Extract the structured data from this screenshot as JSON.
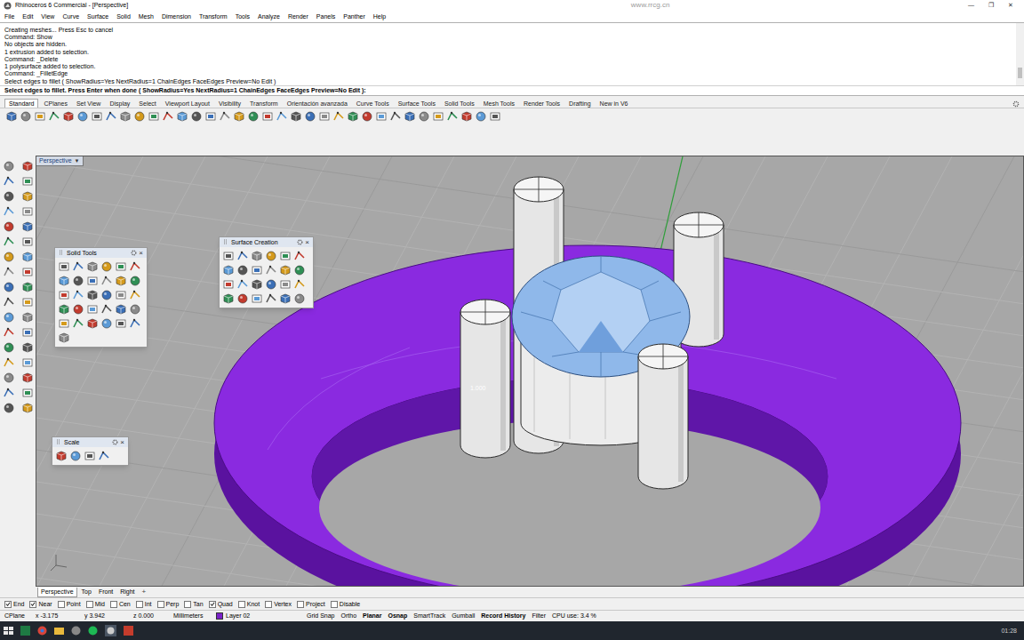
{
  "window": {
    "title": "Rhinoceros 6 Commercial - [Perspective]",
    "watermark": "www.rrcg.cn",
    "controls": [
      "—",
      "❐",
      "✕"
    ]
  },
  "menu": [
    "File",
    "Edit",
    "View",
    "Curve",
    "Surface",
    "Solid",
    "Mesh",
    "Dimension",
    "Transform",
    "Tools",
    "Analyze",
    "Render",
    "Panels",
    "Panther",
    "Help"
  ],
  "command_history": [
    "Creating meshes... Press Esc to cancel",
    "Command: Show",
    "No objects are hidden.",
    "1 extrusion added to selection.",
    "Command: _Delete",
    "1 polysurface added to selection.",
    "Command: _FilletEdge",
    "Select edges to fillet ( ShowRadius=Yes  NextRadius=1  ChainEdges  FaceEdges  Preview=No  Edit )"
  ],
  "command_prompt": "Select edges to fillet. Press Enter when done ( ShowRadius=Yes  NextRadius=1  ChainEdges  FaceEdges  Preview=No  Edit ):",
  "toolbar_tabs": [
    {
      "label": "Standard",
      "selected": true
    },
    {
      "label": "CPlanes",
      "selected": false
    },
    {
      "label": "Set View",
      "selected": false
    },
    {
      "label": "Display",
      "selected": false
    },
    {
      "label": "Select",
      "selected": false
    },
    {
      "label": "Viewport Layout",
      "selected": false
    },
    {
      "label": "Visibility",
      "selected": false
    },
    {
      "label": "Transform",
      "selected": false
    },
    {
      "label": "Orientación avanzada",
      "selected": false
    },
    {
      "label": "Curve Tools",
      "selected": false
    },
    {
      "label": "Surface Tools",
      "selected": false
    },
    {
      "label": "Solid Tools",
      "selected": false
    },
    {
      "label": "Mesh Tools",
      "selected": false
    },
    {
      "label": "Render Tools",
      "selected": false
    },
    {
      "label": "Drafting",
      "selected": false
    },
    {
      "label": "New in V6",
      "selected": false
    }
  ],
  "viewport": {
    "title": "Perspective",
    "dropdown": "▼",
    "dimension_label": "1.000"
  },
  "panels": [
    {
      "title": "Solid Tools",
      "close": "×"
    },
    {
      "title": "Surface Creation",
      "close": "×"
    },
    {
      "title": "Scale",
      "close": "×"
    }
  ],
  "viewport_tabs": [
    {
      "label": "Perspective",
      "selected": true
    },
    {
      "label": "Top",
      "selected": false
    },
    {
      "label": "Front",
      "selected": false
    },
    {
      "label": "Right",
      "selected": false
    }
  ],
  "add_tab": "+",
  "osnaps": [
    {
      "label": "End",
      "checked": true
    },
    {
      "label": "Near",
      "checked": true
    },
    {
      "label": "Point",
      "checked": false
    },
    {
      "label": "Mid",
      "checked": false
    },
    {
      "label": "Cen",
      "checked": false
    },
    {
      "label": "Int",
      "checked": false
    },
    {
      "label": "Perp",
      "checked": false
    },
    {
      "label": "Tan",
      "checked": false
    },
    {
      "label": "Quad",
      "checked": true
    },
    {
      "label": "Knot",
      "checked": false
    },
    {
      "label": "Vertex",
      "checked": false
    },
    {
      "label": "Project",
      "checked": false
    },
    {
      "label": "Disable",
      "checked": false
    }
  ],
  "status_bar": {
    "cplane": "CPlane",
    "x": "x -3.175",
    "y": "y 3.942",
    "z": "z 0.000",
    "units": "Millimeters",
    "layer": {
      "name": "Layer 02",
      "color": "#7b22c9"
    },
    "toggles": [
      {
        "label": "Grid Snap",
        "on": false
      },
      {
        "label": "Ortho",
        "on": false
      },
      {
        "label": "Planar",
        "on": true
      },
      {
        "label": "Osnap",
        "on": true
      },
      {
        "label": "SmartTrack",
        "on": false
      },
      {
        "label": "Gumball",
        "on": false
      },
      {
        "label": "Record History",
        "on": true
      },
      {
        "label": "Filter",
        "on": false
      }
    ],
    "cpu": "CPU use: 3.4 %"
  },
  "taskbar": {
    "time": "01:28"
  }
}
